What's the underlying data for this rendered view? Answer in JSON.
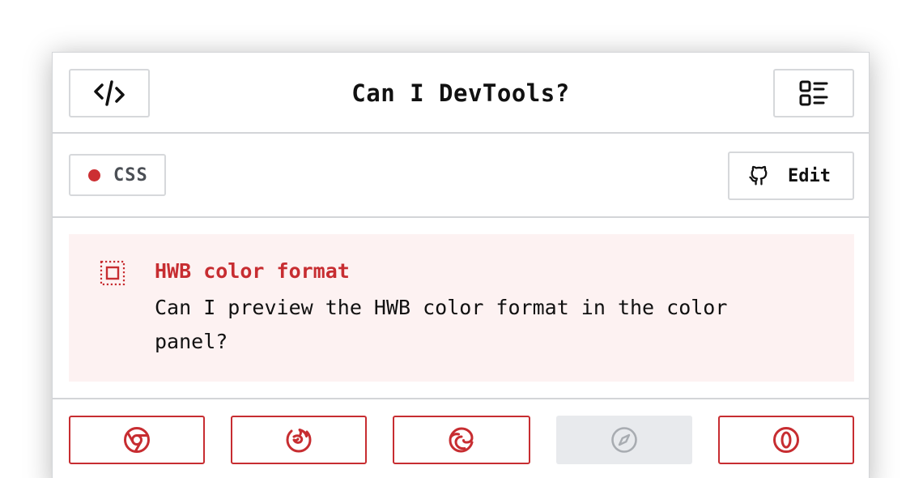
{
  "header": {
    "title": "Can I DevTools?",
    "code_icon": "code-icon",
    "list_icon": "list-icon"
  },
  "subbar": {
    "tag_label": "CSS",
    "tag_color": "#cc2f33",
    "edit_label": "Edit",
    "edit_icon": "github-icon"
  },
  "feature": {
    "icon": "box-model-icon",
    "title": "HWB color format",
    "description": "Can I preview the HWB color format in the color panel?"
  },
  "browsers": [
    {
      "name": "chrome",
      "icon": "chrome-icon",
      "supported": true
    },
    {
      "name": "firefox",
      "icon": "firefox-icon",
      "supported": true
    },
    {
      "name": "edge",
      "icon": "edge-icon",
      "supported": true
    },
    {
      "name": "safari",
      "icon": "safari-icon",
      "supported": false
    },
    {
      "name": "opera",
      "icon": "opera-icon",
      "supported": true
    }
  ],
  "colors": {
    "accent": "#c72d31",
    "feature_bg": "#fdf2f2",
    "disabled_bg": "#e8eaed",
    "border": "#d3d5d8"
  }
}
